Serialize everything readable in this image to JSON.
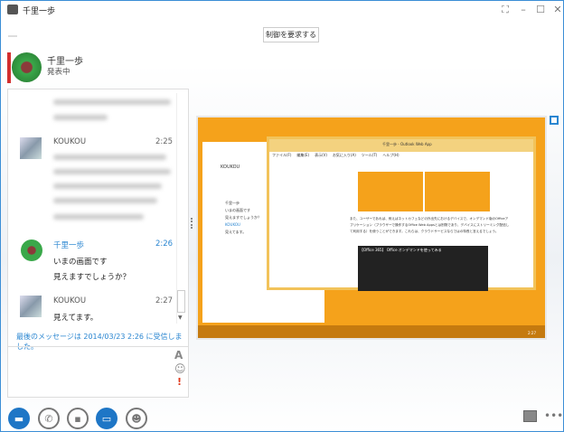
{
  "window": {
    "title": "千里一歩"
  },
  "toolbar": {
    "request_control": "制御を要求する"
  },
  "presenter": {
    "name": "千里一歩",
    "status": "発表中"
  },
  "messages": [
    {
      "sender": "KOUKOU",
      "time": "2:25",
      "lines": []
    },
    {
      "sender": "千里一歩",
      "time": "2:26",
      "lines": [
        "いまの画面です",
        "見えますでしょうか？"
      ]
    },
    {
      "sender": "KOUKOU",
      "time": "2:27",
      "lines": [
        "見えてます。"
      ]
    }
  ],
  "last_message_note": "最後のメッセージは 2014/03/23 2:26 に受信しました。",
  "input_icons": {
    "font": "A",
    "emoticon": "☺",
    "priority": "!"
  },
  "shared_screen": {
    "ie_tab": "千里一歩 - Outlook Web App",
    "ie_menu": [
      "ファイル(F)",
      "編集(E)",
      "表示(V)",
      "お気に入り(A)",
      "ツール(T)",
      "ヘルプ(H)"
    ],
    "lync_contact": "KOUKOU",
    "lync_msgs": [
      "千里一歩",
      "いまの画面です",
      "見えますでしょうか？",
      "KOUKOU",
      "見えてます。"
    ],
    "article": "また、ユーザーであれば、例えばネットカフェなどの外出先におけるデバイスで、オンデマンド版のOfficeアプリケーション（ブラウザーで操作するOffice Web Appsとは別物であり、デバイスにストリーミング配信して利用する）を使うことができます。これらは、クラウドサービスならではの特長と言えるでしょう。",
    "video_title": "【Office 365】 Office オンデマンドを使ってみる",
    "clock": "2:27"
  },
  "colors": {
    "accent": "#2a86d1",
    "presenting": "#d32f2f",
    "desktop": "#f5a21b"
  }
}
